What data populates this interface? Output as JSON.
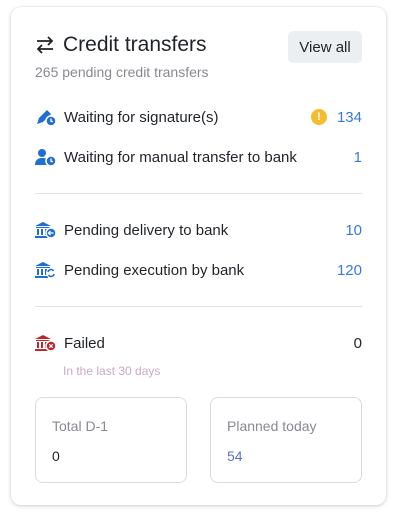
{
  "header": {
    "title": "Credit transfers",
    "subtitle": "265 pending credit transfers",
    "view_all": "View all"
  },
  "rows": [
    {
      "label": "Waiting for signature(s)",
      "value": "134",
      "icon": "pen-clock-icon",
      "warning": "!"
    },
    {
      "label": "Waiting for manual transfer to bank",
      "value": "1",
      "icon": "user-clock-icon"
    },
    {
      "label": "Pending delivery to bank",
      "value": "10",
      "icon": "bank-arrow-icon"
    },
    {
      "label": "Pending execution by bank",
      "value": "120",
      "icon": "bank-refresh-icon"
    },
    {
      "label": "Failed",
      "value": "0",
      "icon": "bank-error-icon",
      "note": "In the last 30 days"
    }
  ],
  "stats": [
    {
      "label": "Total D-1",
      "value": "0"
    },
    {
      "label": "Planned today",
      "value": "54"
    }
  ],
  "colors": {
    "accent": "#3b78d8",
    "icon": "#1f6fd1",
    "error": "#b8282e",
    "warning": "#f6bb2e"
  }
}
